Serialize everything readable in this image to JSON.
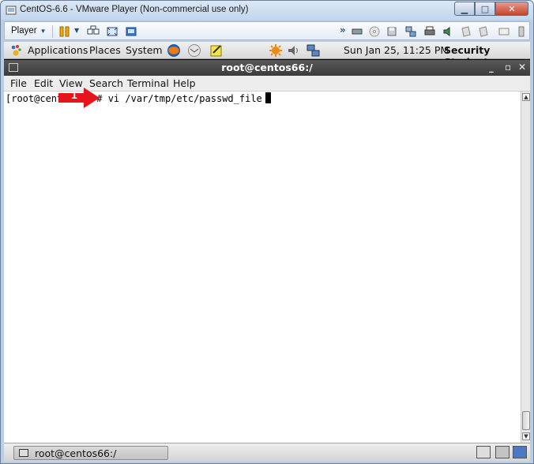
{
  "vm_window": {
    "title": "CentOS-6.6 - VMware Player (Non-commercial use only)",
    "controls": {
      "minimize": "▁",
      "maximize": "□",
      "close": "✕"
    }
  },
  "vm_toolbar": {
    "player_menu": "Player",
    "icons": [
      "pause-icon",
      "send-keys-icon",
      "network-icon",
      "fullscreen-icon",
      "unity-icon",
      "more-chevron-icon",
      "hdd-icon",
      "cd-icon",
      "floppy-icon",
      "usb-icon",
      "printer-icon",
      "sound-icon",
      "device-icon",
      "device2-icon",
      "message-icon",
      "usb2-icon"
    ]
  },
  "gnome_top_panel": {
    "menus": [
      "Applications",
      "Places",
      "System"
    ],
    "clock": "Sun Jan 25, 11:25 PM",
    "user": "Security Student"
  },
  "terminal": {
    "title": "root@centos66:/",
    "menus": [
      "File",
      "Edit",
      "View",
      "Search",
      "Terminal",
      "Help"
    ],
    "prompt_prefix": "[root@cent",
    "prompt_suffix": "# vi /var/tmp/etc/passwd_file",
    "controls": {
      "minimize": "_",
      "maximize": "▫",
      "close": "✕"
    }
  },
  "bottom_panel": {
    "task_label": "root@centos66:/"
  },
  "annotation": {
    "step_number": "1",
    "color": "#e8141b"
  },
  "colors": {
    "vm_frame": "#b9cde5",
    "terminal_title_bg": "#4a4a4a",
    "annotation_red": "#e8141b"
  }
}
